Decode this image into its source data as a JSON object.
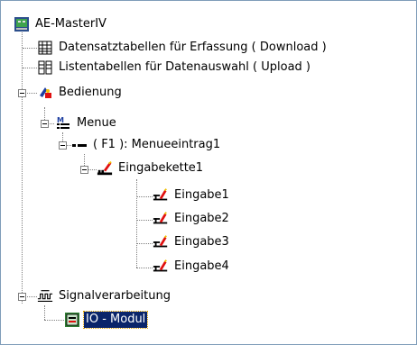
{
  "tree": {
    "root": {
      "label": "AE-MasterIV",
      "icon": "pc-icon"
    },
    "datensatz": {
      "label": "Datensatztabellen für Erfassung ( Download )",
      "icon": "grid-table-icon"
    },
    "listen": {
      "label": "Listentabellen für Datenauswahl ( Upload )",
      "icon": "list-table-icon"
    },
    "bedienung": {
      "label": "Bedienung",
      "icon": "operation-icon"
    },
    "menue": {
      "label": "Menue",
      "icon": "menu-icon"
    },
    "menueeintrag": {
      "label": "( F1 ): Menueeintrag1",
      "icon": "menu-entry-icon"
    },
    "eingabekette": {
      "label": "Eingabekette1",
      "icon": "input-chain-icon"
    },
    "eingaben": [
      {
        "label": "Eingabe1",
        "icon": "input-icon"
      },
      {
        "label": "Eingabe2",
        "icon": "input-icon"
      },
      {
        "label": "Eingabe3",
        "icon": "input-icon"
      },
      {
        "label": "Eingabe4",
        "icon": "input-icon"
      }
    ],
    "signal": {
      "label": "Signalverarbeitung",
      "icon": "signal-icon"
    },
    "iomodul": {
      "label": "IO - Modul",
      "icon": "module-icon",
      "selected": true
    }
  },
  "colors": {
    "selection": "#0a246a",
    "selection_text": "#ffffff",
    "tree_lines": "#808080"
  }
}
